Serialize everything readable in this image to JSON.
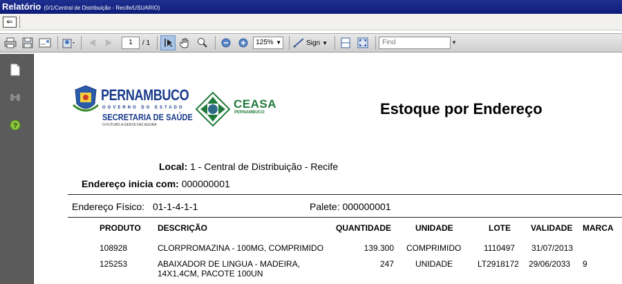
{
  "window": {
    "title": "Relatório",
    "subtitle": "(0/1/Central de Distribuição - Recife/USUARIO)",
    "back_glyph": "⇐"
  },
  "toolbar": {
    "page_current": "1",
    "page_total": "/ 1",
    "zoom": "125%",
    "sign_label": "Sign",
    "find_placeholder": "Find"
  },
  "logos": {
    "pernambuco_name": "PERNAMBUCO",
    "pernambuco_gov": "GOVERNO DO ESTADO",
    "pernambuco_sec": "SECRETARIA DE SAÚDE",
    "pernambuco_slogan": "O FUTURO A GENTE FAZ AGORA",
    "ceasa_name": "CEASA",
    "ceasa_sub": "PERNAMBUCO"
  },
  "report": {
    "title": "Estoque por Endereço",
    "local_label": "Local:",
    "local_value": "1 - Central de Distribuição -  Recife",
    "address_label": "Endereço inicia com:",
    "address_value": "000000001",
    "endfis_label": "Endereço Físico:",
    "endfis_value": "01-1-4-1-1",
    "palete_label": "Palete:",
    "palete_value": "000000001"
  },
  "table": {
    "headers": {
      "produto": "PRODUTO",
      "descricao": "DESCRIÇÃO",
      "quantidade": "QUANTIDADE",
      "unidade": "UNIDADE",
      "lote": "LOTE",
      "validade": "VALIDADE",
      "marca": "MARCA"
    },
    "rows": [
      {
        "produto": "108928",
        "descricao": "CLORPROMAZINA - 100MG, COMPRIMIDO",
        "descricao2": "",
        "quantidade": "139.300",
        "unidade": "COMPRIMIDO",
        "lote": "1110497",
        "validade": "31/07/2013",
        "marca": ""
      },
      {
        "produto": "125253",
        "descricao": "ABAIXADOR DE LINGUA - MADEIRA,",
        "descricao2": "14X1,4CM, PACOTE 100UN",
        "quantidade": "247",
        "unidade": "UNIDADE",
        "lote": "LT2918172",
        "validade": "29/06/2033",
        "marca": "9"
      }
    ]
  }
}
